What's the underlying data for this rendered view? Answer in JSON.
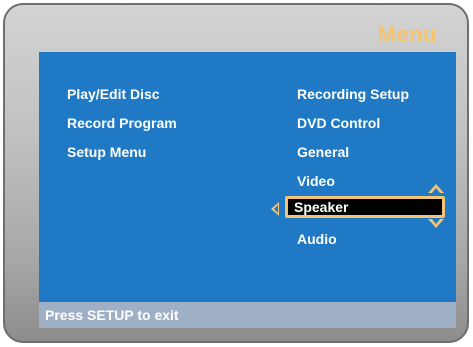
{
  "menu": {
    "title": "Menu"
  },
  "left_items": [
    "Play/Edit Disc",
    "Record Program",
    "Setup Menu"
  ],
  "right_items": [
    "Recording Setup",
    "DVD Control",
    "General",
    "Video",
    "Speaker",
    "Audio"
  ],
  "selected": {
    "label": "Speaker"
  },
  "status": {
    "text": "Press SETUP to exit"
  },
  "colors": {
    "accent": "#f2c475",
    "screen_blue": "#1f79c4",
    "title": "#f7c36b"
  }
}
